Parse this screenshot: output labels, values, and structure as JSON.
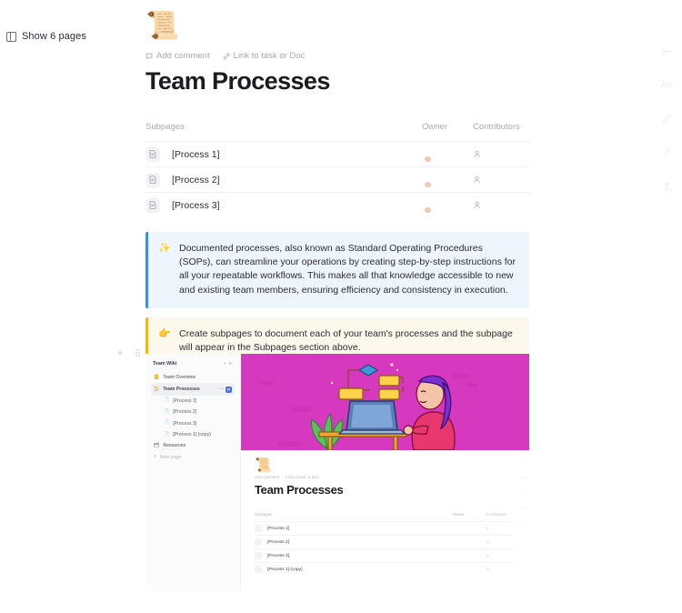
{
  "topbar": {
    "show_pages_label": "Show 6 pages",
    "show_pages_icon": "sidebar-panel-icon"
  },
  "right_rail": {
    "items": [
      {
        "name": "collapse-width-icon",
        "glyph": "⇥"
      },
      {
        "name": "font-size-icon",
        "glyph": "Aa"
      },
      {
        "name": "link-icon",
        "glyph": "⤵"
      },
      {
        "name": "magic-wand-icon",
        "glyph": "✦"
      },
      {
        "name": "upload-icon",
        "glyph": "⇧"
      }
    ]
  },
  "doc": {
    "icon": "📜",
    "icon_name": "scroll-emoji-icon",
    "title": "Team Processes",
    "meta": [
      {
        "label": "Add comment",
        "icon": "comment-icon"
      },
      {
        "label": "Link to task or Doc",
        "icon": "link-bolt-icon"
      }
    ]
  },
  "subpages": {
    "columns": {
      "name": "Subpages",
      "owner": "Owner",
      "contributors": "Contributors"
    },
    "rows": [
      {
        "label": "[Process 1]",
        "owner": "avatar",
        "contributors": "person-outline-icon"
      },
      {
        "label": "[Process 2]",
        "owner": "avatar",
        "contributors": "person-outline-icon"
      },
      {
        "label": "[Process 3]",
        "owner": "avatar",
        "contributors": "person-outline-icon"
      }
    ]
  },
  "callouts": [
    {
      "emoji": "✨",
      "emoji_name": "sparkles-emoji-icon",
      "accent": "#3f8ce0",
      "background": "#eef5fd",
      "text": "Documented processes, also known as Standard Operating Procedures (SOPs), can streamline your operations by creating step-by-step instructions for all your repeatable workflows. This makes all that knowledge accessible to new and existing team members, ensuring efficiency and consistency in execution."
    },
    {
      "emoji": "👉",
      "emoji_name": "pointing-finger-emoji-icon",
      "accent": "#f0b429",
      "background": "#fdf8ec",
      "text": "Create subpages to document each of your team's processes and the subpage will appear in the Subpages section above."
    }
  ],
  "embed": {
    "tools": [
      {
        "name": "add-block-button",
        "glyph": "+"
      },
      {
        "name": "drag-handle",
        "glyph": "∷"
      }
    ],
    "sidebar": {
      "title": "Team Wiki",
      "header_icons": [
        {
          "name": "search-icon",
          "glyph": "⌕"
        },
        {
          "name": "collapse-icon",
          "glyph": "⇤"
        }
      ],
      "items": [
        {
          "label": "Team Overview",
          "icon": "📒",
          "indent": false,
          "selected": false,
          "dim": false
        },
        {
          "label": "Team Processes",
          "icon": "📜",
          "indent": false,
          "selected": true,
          "dim": false,
          "badge": "P"
        },
        {
          "label": "[Process 1]",
          "icon": "📄",
          "indent": true,
          "selected": false,
          "dim": false
        },
        {
          "label": "[Process 2]",
          "icon": "📄",
          "indent": true,
          "selected": false,
          "dim": false
        },
        {
          "label": "[Process 3]",
          "icon": "📄",
          "indent": true,
          "selected": false,
          "dim": false
        },
        {
          "label": "[Process 1] (copy)",
          "icon": "📄",
          "indent": true,
          "selected": false,
          "dim": false
        },
        {
          "label": "Resources",
          "icon": "🗂",
          "indent": false,
          "selected": false,
          "dim": false
        },
        {
          "label": "New page",
          "icon": "+",
          "indent": false,
          "selected": false,
          "dim": true
        }
      ]
    },
    "hero": {
      "name": "cover-illustration",
      "description": "Woman working at a laptop with a flowchart diagram",
      "background": "#d638c0"
    },
    "doc": {
      "icon": "📜",
      "title": "Team Processes",
      "meta": [
        {
          "label": "Add comment",
          "icon": "comment-icon"
        },
        {
          "label": "Link to task or Doc",
          "icon": "link-bolt-icon"
        }
      ]
    },
    "subpages": {
      "columns": {
        "name": "Subpages",
        "owner": "Owner",
        "contributors": "Contributors"
      },
      "rows": [
        {
          "label": "[Process 1]"
        },
        {
          "label": "[Process 2]"
        },
        {
          "label": "[Process 3]"
        },
        {
          "label": "[Process 1] (copy)"
        }
      ]
    },
    "rail": [
      {
        "name": "collapse-width-icon",
        "glyph": "⇥"
      },
      {
        "name": "font-size-icon",
        "glyph": "Aa"
      },
      {
        "name": "link-icon",
        "glyph": "⤵"
      },
      {
        "name": "magic-wand-icon",
        "glyph": "✦"
      },
      {
        "name": "upload-icon",
        "glyph": "⇧"
      }
    ]
  }
}
